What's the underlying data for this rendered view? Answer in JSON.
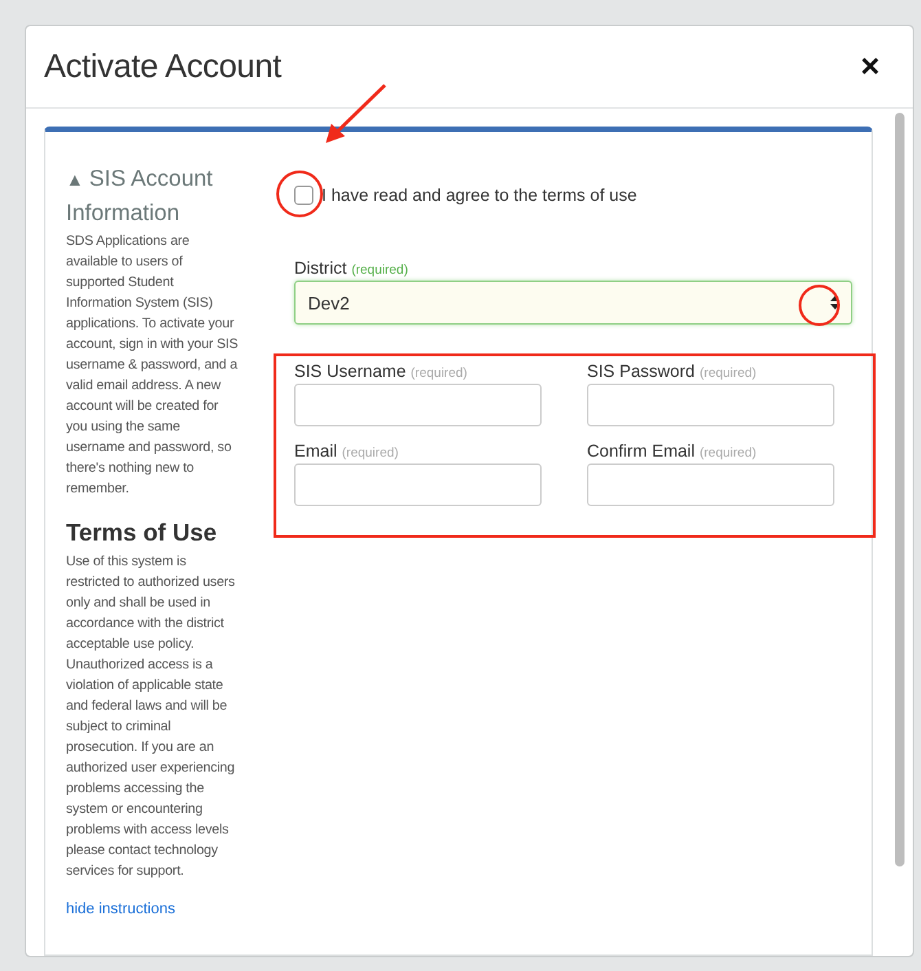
{
  "window": {
    "title": "Activate Account",
    "close": "×"
  },
  "instructions": {
    "expanded": true,
    "caret": "▲",
    "heading": "SIS Account Information",
    "intro": "SDS Applications are available to users of supported Student Information System (SIS) applications. To activate your account, sign in with your SIS username & password, and a valid email address. A new account will be created for you using the same username and password, so there's nothing new to remember.",
    "terms_heading": "Terms of Use",
    "terms": "Use of this system is restricted to authorized users only and shall be used in accordance with the district acceptable use policy. Unauthorized access is a violation of applicable state and federal laws and will be subject to criminal prosecution. If you are an authorized user experiencing problems accessing the system or encountering problems with access levels please contact technology services for support.",
    "toggle_link": "hide instructions"
  },
  "agree": {
    "label": "I have read and agree to the terms of use",
    "checked": false
  },
  "district": {
    "label": "District",
    "hint": "(required)",
    "value": "Dev2",
    "valid": true
  },
  "fields": [
    {
      "label": "SIS Username",
      "hint": "(required)"
    },
    {
      "label": "SIS Password",
      "hint": "(required)"
    },
    {
      "label": "Email",
      "hint": "(required)"
    },
    {
      "label": "Confirm Email",
      "hint": "(required)"
    }
  ]
}
